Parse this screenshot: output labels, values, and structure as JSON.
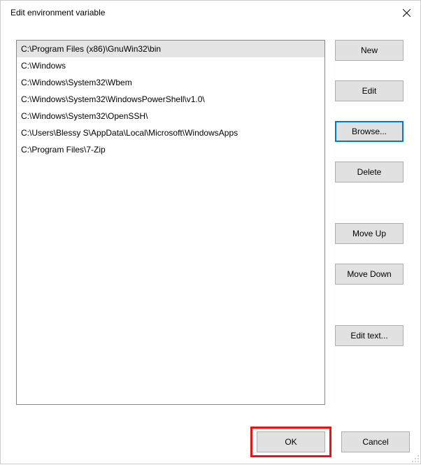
{
  "titlebar": {
    "title": "Edit environment variable"
  },
  "list": {
    "items": [
      "C:\\Program Files (x86)\\GnuWin32\\bin",
      "C:\\Windows",
      "C:\\Windows\\System32\\Wbem",
      "C:\\Windows\\System32\\WindowsPowerShell\\v1.0\\",
      "C:\\Windows\\System32\\OpenSSH\\",
      "C:\\Users\\Blessy S\\AppData\\Local\\Microsoft\\WindowsApps",
      "C:\\Program Files\\7-Zip"
    ],
    "selected_index": 0
  },
  "buttons": {
    "new": "New",
    "edit": "Edit",
    "browse": "Browse...",
    "delete": "Delete",
    "move_up": "Move Up",
    "move_down": "Move Down",
    "edit_text": "Edit text...",
    "ok": "OK",
    "cancel": "Cancel"
  }
}
